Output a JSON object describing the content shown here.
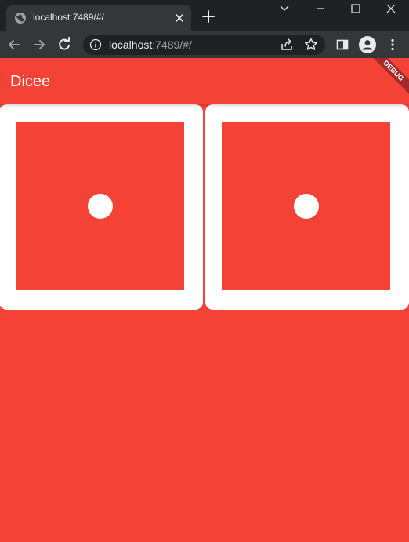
{
  "browser": {
    "tab": {
      "title": "localhost:7489/#/"
    },
    "address_bar": {
      "host": "localhost",
      "path": ":7489/#/"
    }
  },
  "app": {
    "title": "Dicee",
    "debug_banner": "DEBUG",
    "colors": {
      "primary": "#f44336",
      "die_border": "#ffffff",
      "pip": "#ffffff",
      "debug_banner": "#a5292a"
    },
    "dice": [
      {
        "value": 1
      },
      {
        "value": 1
      }
    ]
  }
}
